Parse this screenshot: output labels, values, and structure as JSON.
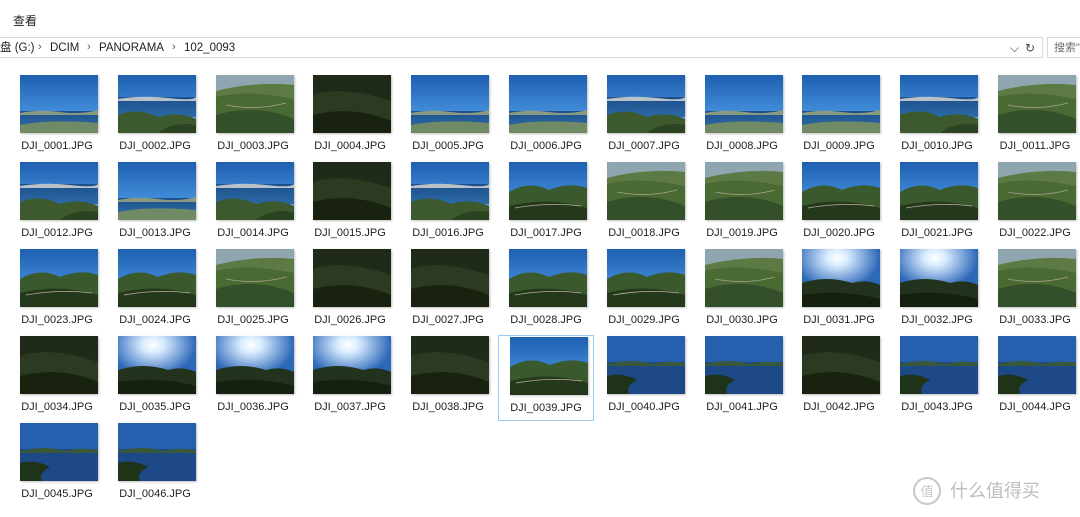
{
  "menu": {
    "view_label": "查看"
  },
  "address": {
    "drive": "盘 (G:)",
    "crumbs": [
      "DCIM",
      "PANORAMA",
      "102_0093"
    ],
    "dropdown_glyph": "⌵",
    "refresh_glyph": "↻"
  },
  "search": {
    "placeholder": "搜索\""
  },
  "files": [
    {
      "name": "DJI_0001.JPG",
      "thumb": "lake"
    },
    {
      "name": "DJI_0002.JPG",
      "thumb": "lake-hills"
    },
    {
      "name": "DJI_0003.JPG",
      "thumb": "hills"
    },
    {
      "name": "DJI_0004.JPG",
      "thumb": "dark-forest"
    },
    {
      "name": "DJI_0005.JPG",
      "thumb": "lake"
    },
    {
      "name": "DJI_0006.JPG",
      "thumb": "lake"
    },
    {
      "name": "DJI_0007.JPG",
      "thumb": "lake-hills"
    },
    {
      "name": "DJI_0008.JPG",
      "thumb": "lake"
    },
    {
      "name": "DJI_0009.JPG",
      "thumb": "lake"
    },
    {
      "name": "DJI_0010.JPG",
      "thumb": "lake-hills"
    },
    {
      "name": "DJI_0011.JPG",
      "thumb": "hills"
    },
    {
      "name": "DJI_0012.JPG",
      "thumb": "lake-hills"
    },
    {
      "name": "DJI_0013.JPG",
      "thumb": "lake"
    },
    {
      "name": "DJI_0014.JPG",
      "thumb": "lake-hills"
    },
    {
      "name": "DJI_0015.JPG",
      "thumb": "dark-forest"
    },
    {
      "name": "DJI_0016.JPG",
      "thumb": "lake-hills"
    },
    {
      "name": "DJI_0017.JPG",
      "thumb": "sky-ridge"
    },
    {
      "name": "DJI_0018.JPG",
      "thumb": "hills"
    },
    {
      "name": "DJI_0019.JPG",
      "thumb": "hills"
    },
    {
      "name": "DJI_0020.JPG",
      "thumb": "sky-ridge"
    },
    {
      "name": "DJI_0021.JPG",
      "thumb": "sky-ridge"
    },
    {
      "name": "DJI_0022.JPG",
      "thumb": "hills"
    },
    {
      "name": "DJI_0023.JPG",
      "thumb": "sky-ridge"
    },
    {
      "name": "DJI_0024.JPG",
      "thumb": "sky-ridge"
    },
    {
      "name": "DJI_0025.JPG",
      "thumb": "hills"
    },
    {
      "name": "DJI_0026.JPG",
      "thumb": "dark-forest"
    },
    {
      "name": "DJI_0027.JPG",
      "thumb": "dark-forest"
    },
    {
      "name": "DJI_0028.JPG",
      "thumb": "sky-ridge"
    },
    {
      "name": "DJI_0029.JPG",
      "thumb": "sky-ridge"
    },
    {
      "name": "DJI_0030.JPG",
      "thumb": "hills"
    },
    {
      "name": "DJI_0031.JPG",
      "thumb": "sun"
    },
    {
      "name": "DJI_0032.JPG",
      "thumb": "sun"
    },
    {
      "name": "DJI_0033.JPG",
      "thumb": "hills"
    },
    {
      "name": "DJI_0034.JPG",
      "thumb": "dark-forest"
    },
    {
      "name": "DJI_0035.JPG",
      "thumb": "sun"
    },
    {
      "name": "DJI_0036.JPG",
      "thumb": "sun"
    },
    {
      "name": "DJI_0037.JPG",
      "thumb": "sun"
    },
    {
      "name": "DJI_0038.JPG",
      "thumb": "dark-forest"
    },
    {
      "name": "DJI_0039.JPG",
      "thumb": "sky-ridge",
      "selected": true
    },
    {
      "name": "DJI_0040.JPG",
      "thumb": "deep-lake"
    },
    {
      "name": "DJI_0041.JPG",
      "thumb": "deep-lake"
    },
    {
      "name": "DJI_0042.JPG",
      "thumb": "dark-forest"
    },
    {
      "name": "DJI_0043.JPG",
      "thumb": "deep-lake"
    },
    {
      "name": "DJI_0044.JPG",
      "thumb": "deep-lake"
    },
    {
      "name": "DJI_0045.JPG",
      "thumb": "deep-lake"
    },
    {
      "name": "DJI_0046.JPG",
      "thumb": "deep-lake"
    }
  ],
  "watermark": {
    "text": "什么值得买",
    "icon": "smzdm-logo-icon"
  }
}
